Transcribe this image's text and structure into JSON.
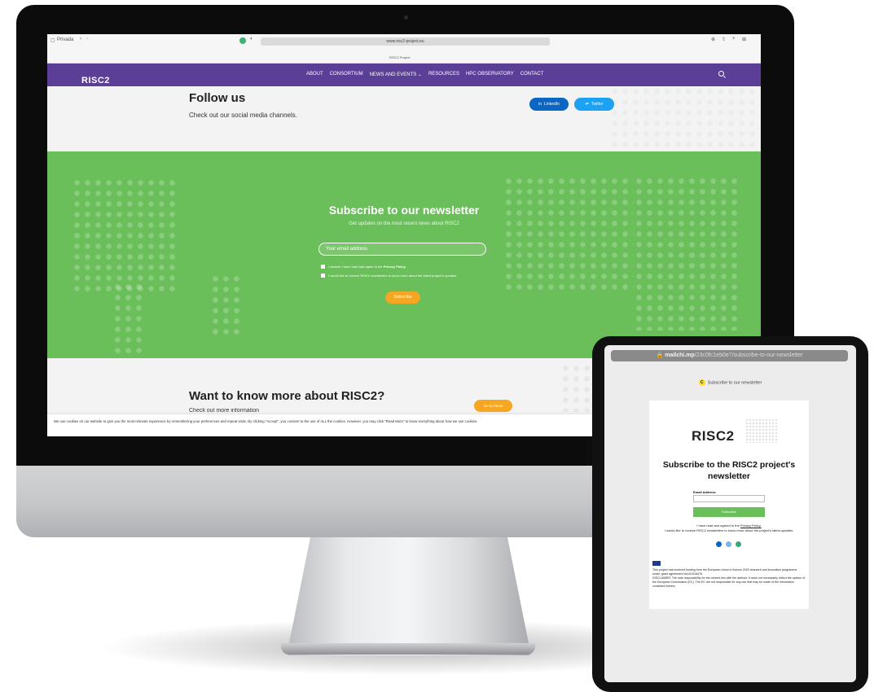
{
  "desktop": {
    "browser": {
      "window_label": "Privada",
      "url": "www.risc2-project.eu",
      "tab_title": "RISC2 Project"
    },
    "nav": {
      "logo": "RISC2",
      "links": [
        "ABOUT",
        "CONSORTIUM",
        "NEWS AND EVENTS ⌄",
        "RESOURCES",
        "HPC OBSERVATORY",
        "CONTACT"
      ]
    },
    "follow": {
      "title": "Follow us",
      "subtitle": "Check out our social media channels.",
      "linkedin_label": "LinkedIn",
      "twitter_label": "Twitter"
    },
    "newsletter": {
      "title": "Subscribe to our newsletter",
      "subtitle": "Get updates on the most recent news about RISC2",
      "email_placeholder": "Your email address",
      "consent_privacy_prefix": "I declare I have read and agree to the",
      "consent_privacy_link": "Privacy Policy",
      "consent_newsletter": "I would like to receive RISC2 newsletters to know more about the latest project's updates.",
      "button": "Subscribe"
    },
    "more": {
      "title": "Want to know more about RISC2?",
      "subtitle": "Check out more information",
      "button": "Go to About"
    },
    "cookie_text": "We use cookies on our website to give you the most relevant experience by remembering your preferences and repeat visits. By clicking \"Accept\", you consent to the use of ALL the cookies. However, you may click \"Read More\" to know everything about how we use cookies."
  },
  "tablet": {
    "url_domain": "mailchi.mp",
    "url_path": "/23c0fc1eb0e7/subscribe-to-our-newsletter",
    "tab_title": "Subscribe to our newsletter",
    "logo": "RISC2",
    "title": "Subscribe to the RISC2 project's newsletter",
    "email_label": "Email Address",
    "button": "Subscribe",
    "consent_prefix": "I have read and agreed to the",
    "consent_link": "Privacy Policy.",
    "consent_newsletter": "I would like to receive RISC2 newsletters to know more about the project's latest updates.",
    "funding": "This project has received funding from the European Union's Horizon 2020 research and innovation programme under, grant agreement No101016476.",
    "disclaimer": "DISCLAIMER: The sole responsibility for the content lies with the authors. It does not necessarily reflect the opinion of the European Commission (EC). The EC are not responsible for any use that may be made of the information contained therein."
  },
  "colors": {
    "nav_purple": "#5b3f97",
    "newsletter_green": "#6abf5a",
    "accent_orange": "#f5a623",
    "linkedin_blue": "#0a66c2",
    "twitter_blue": "#1da1f2"
  }
}
